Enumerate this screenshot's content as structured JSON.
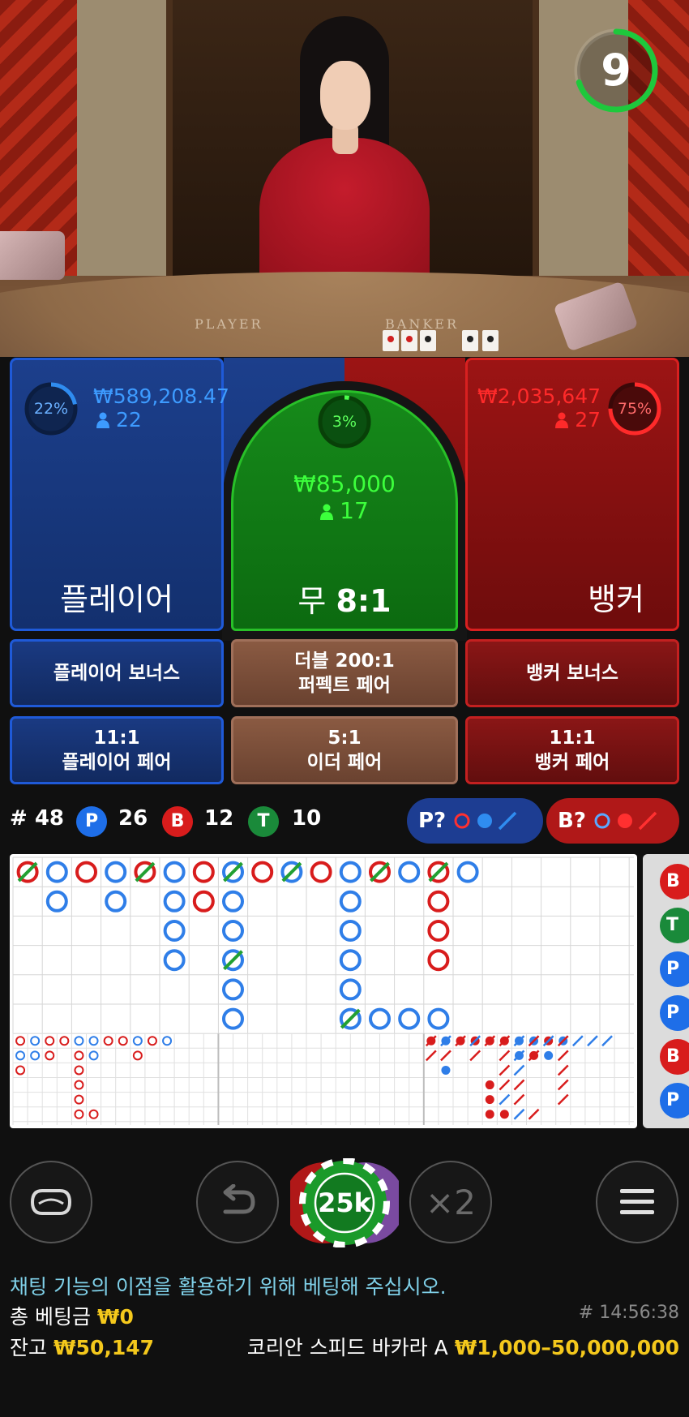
{
  "video": {
    "table_player_label": "PLAYER",
    "table_banker_label": "BANKER",
    "countdown": "9",
    "countdown_fraction": 0.7
  },
  "player_zone": {
    "percent": "22%",
    "percent_value": 0.22,
    "amount": "₩589,208.47",
    "bettors": "22",
    "label": "플레이어"
  },
  "tie_zone": {
    "percent": "3%",
    "percent_value": 0.03,
    "amount": "₩85,000",
    "bettors": "17",
    "label": "무",
    "payout": "8:1"
  },
  "banker_zone": {
    "percent": "75%",
    "percent_value": 0.75,
    "amount": "₩2,035,647",
    "bettors": "27",
    "label": "뱅커"
  },
  "side_bets": {
    "player_bonus": "플레이어 보너스",
    "perfect_pair_line1": "더블 200:1",
    "perfect_pair_line2": "퍼펙트 페어",
    "banker_bonus": "뱅커 보너스",
    "player_pair_line1": "11:1",
    "player_pair_line2": "플레이어 페어",
    "either_pair_line1": "5:1",
    "either_pair_line2": "이더 페어",
    "banker_pair_line1": "11:1",
    "banker_pair_line2": "뱅커 페어"
  },
  "stats": {
    "round_label": "# 48",
    "player_badge": "P",
    "player_count": "26",
    "banker_badge": "B",
    "banker_count": "12",
    "tie_badge": "T",
    "tie_count": "10",
    "predict_player": "P?",
    "predict_banker": "B?"
  },
  "road_side": [
    "B",
    "T",
    "P",
    "P",
    "B",
    "P"
  ],
  "colors": {
    "player": "#1f5ad8",
    "banker": "#d82020",
    "tie": "#22b022",
    "gold": "#f4c81c",
    "chat_hint": "#7fd0e8"
  },
  "controls": {
    "chip_value": "25k",
    "double_label": "×2",
    "icons": [
      "table-view-icon",
      "undo-icon",
      "double-icon",
      "menu-icon"
    ]
  },
  "footer": {
    "chat_hint": "채팅 기능의 이점을 활용하기 위해 베팅해 주십시오.",
    "total_bet_label": "총 베팅금",
    "total_bet_value": "₩0",
    "round_id": "# 14:56:38",
    "balance_label": "잔고",
    "balance_value": "₩50,147",
    "table_name": "코리안 스피드 바카라 A",
    "limits": "₩1,000–50,000,000"
  }
}
